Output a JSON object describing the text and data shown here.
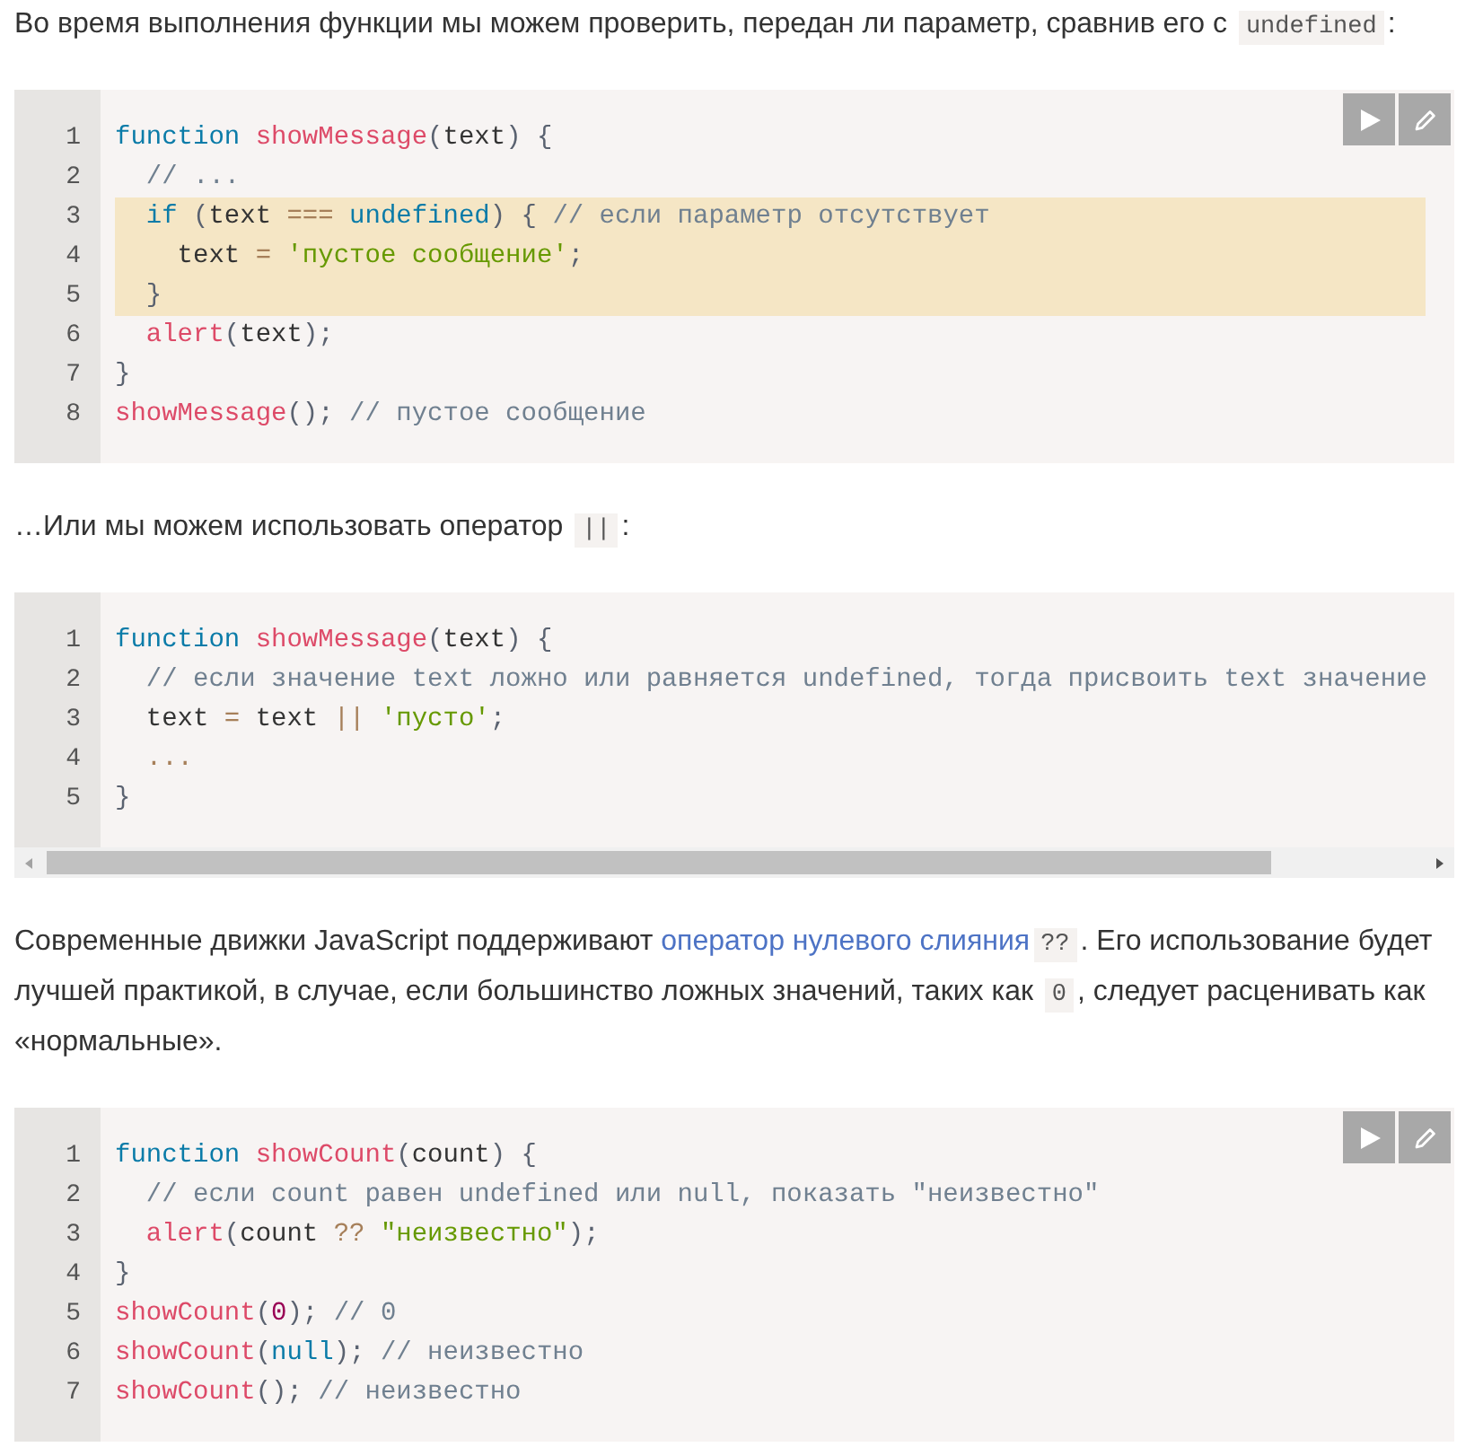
{
  "content": [
    {
      "kind": "paragraph",
      "segments": [
        {
          "kind": "text",
          "text": "Во время выполнения функции мы можем проверить, передан ли параметр, сравнив его с "
        },
        {
          "kind": "code",
          "text": "undefined"
        },
        {
          "kind": "text",
          "text": ":"
        }
      ]
    },
    {
      "kind": "code",
      "buttons": [
        {
          "kind": "run"
        },
        {
          "kind": "edit"
        }
      ],
      "lines": [
        {
          "number": "1",
          "highlighted": false,
          "tokens": [
            {
              "kind": "keyword",
              "text": "function "
            },
            {
              "kind": "function",
              "text": "showMessage"
            },
            {
              "kind": "punct",
              "text": "("
            },
            {
              "kind": "plain",
              "text": "text"
            },
            {
              "kind": "punct",
              "text": ") {"
            }
          ]
        },
        {
          "number": "2",
          "highlighted": false,
          "tokens": [
            {
              "kind": "comment",
              "text": "  // ..."
            }
          ]
        },
        {
          "number": "3",
          "highlighted": true,
          "tokens": [
            {
              "kind": "keyword",
              "text": "  if "
            },
            {
              "kind": "punct",
              "text": "("
            },
            {
              "kind": "plain",
              "text": "text "
            },
            {
              "kind": "operator",
              "text": "=== "
            },
            {
              "kind": "keyword",
              "text": "undefined"
            },
            {
              "kind": "punct",
              "text": ") { "
            },
            {
              "kind": "comment",
              "text": "// если параметр отсутствует"
            }
          ]
        },
        {
          "number": "4",
          "highlighted": true,
          "tokens": [
            {
              "kind": "plain",
              "text": "    text "
            },
            {
              "kind": "operator",
              "text": "= "
            },
            {
              "kind": "string",
              "text": "'пустое сообщение'"
            },
            {
              "kind": "punct",
              "text": ";"
            }
          ]
        },
        {
          "number": "5",
          "highlighted": true,
          "tokens": [
            {
              "kind": "punct",
              "text": "  }"
            }
          ]
        },
        {
          "number": "6",
          "highlighted": false,
          "tokens": [
            {
              "kind": "function",
              "text": "  alert"
            },
            {
              "kind": "punct",
              "text": "("
            },
            {
              "kind": "plain",
              "text": "text"
            },
            {
              "kind": "punct",
              "text": ");"
            }
          ]
        },
        {
          "number": "7",
          "highlighted": false,
          "tokens": [
            {
              "kind": "punct",
              "text": "}"
            }
          ]
        },
        {
          "number": "8",
          "highlighted": false,
          "tokens": [
            {
              "kind": "function",
              "text": "showMessage"
            },
            {
              "kind": "punct",
              "text": "(); "
            },
            {
              "kind": "comment",
              "text": "// пустое сообщение"
            }
          ]
        }
      ]
    },
    {
      "kind": "paragraph",
      "segments": [
        {
          "kind": "text",
          "text": "…Или мы можем использовать оператор "
        },
        {
          "kind": "code",
          "text": "||"
        },
        {
          "kind": "text",
          "text": ":"
        }
      ]
    },
    {
      "kind": "code",
      "scrollable": true,
      "lines": [
        {
          "number": "1",
          "highlighted": false,
          "tokens": [
            {
              "kind": "keyword",
              "text": "function "
            },
            {
              "kind": "function",
              "text": "showMessage"
            },
            {
              "kind": "punct",
              "text": "("
            },
            {
              "kind": "plain",
              "text": "text"
            },
            {
              "kind": "punct",
              "text": ") {"
            }
          ]
        },
        {
          "number": "2",
          "highlighted": false,
          "tokens": [
            {
              "kind": "comment",
              "text": "  // если значение text ложно или равняется undefined, тогда присвоить text значение"
            }
          ]
        },
        {
          "number": "3",
          "highlighted": false,
          "tokens": [
            {
              "kind": "plain",
              "text": "  text "
            },
            {
              "kind": "operator",
              "text": "= "
            },
            {
              "kind": "plain",
              "text": "text "
            },
            {
              "kind": "operator",
              "text": "|| "
            },
            {
              "kind": "string",
              "text": "'пусто'"
            },
            {
              "kind": "punct",
              "text": ";"
            }
          ]
        },
        {
          "number": "4",
          "highlighted": false,
          "tokens": [
            {
              "kind": "operator",
              "text": "  ..."
            }
          ]
        },
        {
          "number": "5",
          "highlighted": false,
          "tokens": [
            {
              "kind": "punct",
              "text": "}"
            }
          ]
        }
      ]
    },
    {
      "kind": "paragraph",
      "segments": [
        {
          "kind": "text",
          "text": "Современные движки JavaScript поддерживают "
        },
        {
          "kind": "link",
          "text": "оператор нулевого слияния"
        },
        {
          "kind": "code",
          "text": "??"
        },
        {
          "kind": "text",
          "text": ". Его использование будет лучшей практикой, в случае, если большинство ложных значений, таких как "
        },
        {
          "kind": "code",
          "text": "0"
        },
        {
          "kind": "text",
          "text": ", следует расценивать как «нормальные»."
        }
      ]
    },
    {
      "kind": "code",
      "buttons": [
        {
          "kind": "run"
        },
        {
          "kind": "edit"
        }
      ],
      "lines": [
        {
          "number": "1",
          "highlighted": false,
          "tokens": [
            {
              "kind": "keyword",
              "text": "function "
            },
            {
              "kind": "function",
              "text": "showCount"
            },
            {
              "kind": "punct",
              "text": "("
            },
            {
              "kind": "plain",
              "text": "count"
            },
            {
              "kind": "punct",
              "text": ") {"
            }
          ]
        },
        {
          "number": "2",
          "highlighted": false,
          "tokens": [
            {
              "kind": "comment",
              "text": "  // если count равен undefined или null, показать \"неизвестно\""
            }
          ]
        },
        {
          "number": "3",
          "highlighted": false,
          "tokens": [
            {
              "kind": "function",
              "text": "  alert"
            },
            {
              "kind": "punct",
              "text": "("
            },
            {
              "kind": "plain",
              "text": "count "
            },
            {
              "kind": "operator",
              "text": "?? "
            },
            {
              "kind": "string",
              "text": "\"неизвестно\""
            },
            {
              "kind": "punct",
              "text": ");"
            }
          ]
        },
        {
          "number": "4",
          "highlighted": false,
          "tokens": [
            {
              "kind": "punct",
              "text": "}"
            }
          ]
        },
        {
          "number": "5",
          "highlighted": false,
          "tokens": [
            {
              "kind": "function",
              "text": "showCount"
            },
            {
              "kind": "punct",
              "text": "("
            },
            {
              "kind": "number",
              "text": "0"
            },
            {
              "kind": "punct",
              "text": "); "
            },
            {
              "kind": "comment",
              "text": "// 0"
            }
          ]
        },
        {
          "number": "6",
          "highlighted": false,
          "tokens": [
            {
              "kind": "function",
              "text": "showCount"
            },
            {
              "kind": "punct",
              "text": "("
            },
            {
              "kind": "keyword",
              "text": "null"
            },
            {
              "kind": "punct",
              "text": "); "
            },
            {
              "kind": "comment",
              "text": "// неизвестно"
            }
          ]
        },
        {
          "number": "7",
          "highlighted": false,
          "tokens": [
            {
              "kind": "function",
              "text": "showCount"
            },
            {
              "kind": "punct",
              "text": "(); "
            },
            {
              "kind": "comment",
              "text": "// неизвестно"
            }
          ]
        }
      ]
    }
  ]
}
